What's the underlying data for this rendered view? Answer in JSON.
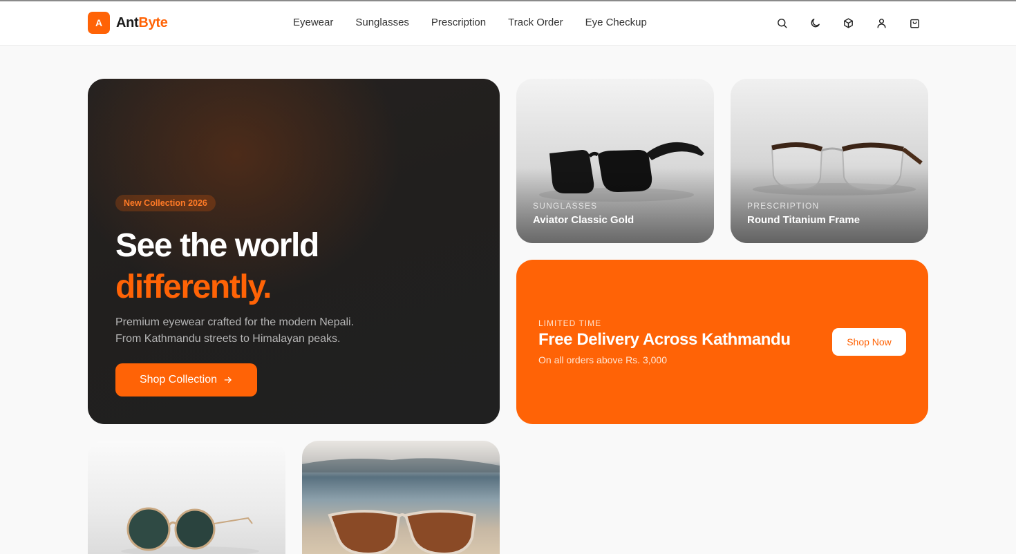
{
  "brand": {
    "badge": "A",
    "name_part1": "Ant",
    "name_part2": "Byte",
    "accent": "#ff6306"
  },
  "nav": {
    "items": [
      {
        "label": "Eyewear"
      },
      {
        "label": "Sunglasses"
      },
      {
        "label": "Prescription"
      },
      {
        "label": "Track Order"
      },
      {
        "label": "Eye Checkup"
      }
    ]
  },
  "header_icons": [
    "search-icon",
    "moon-icon",
    "box-icon",
    "user-icon",
    "shopping-bag-icon"
  ],
  "hero": {
    "badge": "New Collection 2026",
    "title_line1": "See the world",
    "title_line2": "differently.",
    "subtitle_line1": "Premium eyewear crafted for the modern Nepali.",
    "subtitle_line2": "From Kathmandu streets to Himalayan peaks.",
    "cta": "Shop Collection",
    "cta_icon": "arrow-right-icon"
  },
  "products": [
    {
      "category": "SUNGLASSES",
      "name": "Aviator Classic Gold"
    },
    {
      "category": "PRESCRIPTION",
      "name": "Round Titanium Frame"
    }
  ],
  "promo": {
    "tag": "LIMITED TIME",
    "title": "Free Delivery Across Kathmandu",
    "description": "On all orders above Rs. 3,000",
    "button": "Shop Now"
  }
}
